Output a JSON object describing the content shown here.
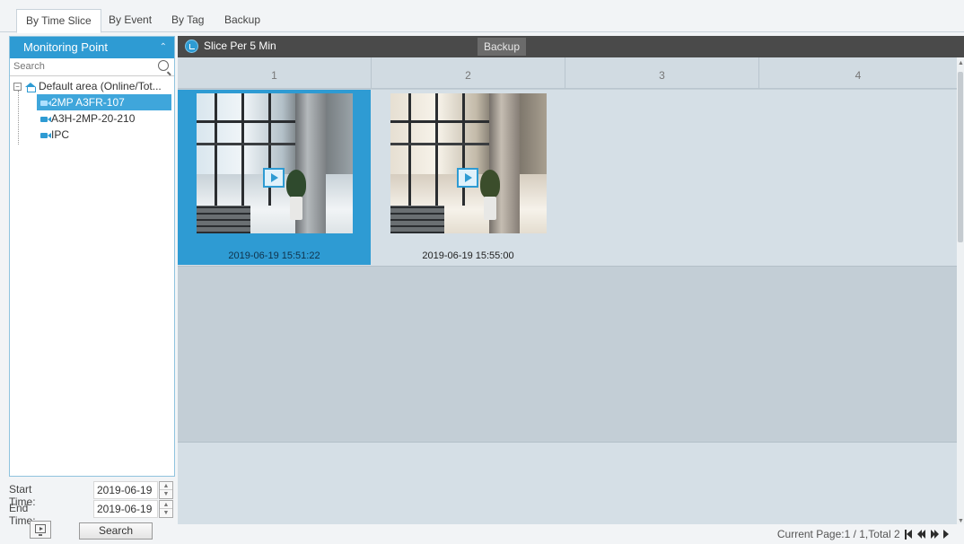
{
  "tabs": [
    {
      "label": "By Time Slice",
      "active": true
    },
    {
      "label": "By Event",
      "active": false
    },
    {
      "label": "By Tag",
      "active": false
    },
    {
      "label": "Backup",
      "active": false
    }
  ],
  "monitoring": {
    "title": "Monitoring Point",
    "search_placeholder": "Search",
    "root_label": "Default area (Online/Tot...",
    "devices": [
      {
        "label": "2MP A3FR-107",
        "selected": true
      },
      {
        "label": "A3H-2MP-20-210",
        "selected": false
      },
      {
        "label": "IPC",
        "selected": false
      }
    ]
  },
  "filters": {
    "start_label": "Start Time:",
    "start_value": "2019-06-19",
    "end_label": "End Time:",
    "end_value": "2019-06-19",
    "search_button": "Search"
  },
  "toolbar": {
    "slice_label": "Slice Per 5 Min",
    "backup_label": "Backup"
  },
  "grid": {
    "columns": [
      "1",
      "2",
      "3",
      "4"
    ],
    "thumbnails": [
      {
        "timestamp": "2019-06-19 15:51:22",
        "selected": true
      },
      {
        "timestamp": "2019-06-19 15:55:00",
        "selected": false
      }
    ]
  },
  "pager": {
    "text": "Current Page:1 / 1,Total 2"
  },
  "colors": {
    "accent": "#2e9bd3",
    "toolbar_bg": "#4a4a4a",
    "grid_bg": "#c3ced6"
  }
}
